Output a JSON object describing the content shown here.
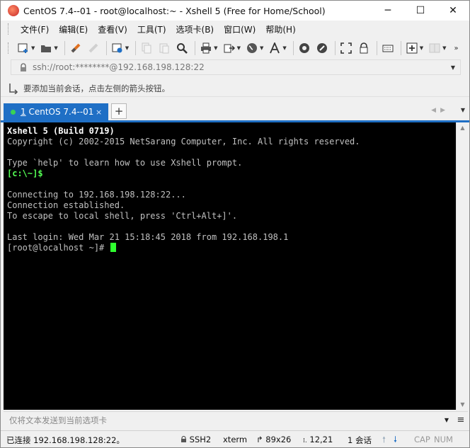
{
  "window": {
    "title": "CentOS 7.4--01 - root@localhost:~ - Xshell 5 (Free for Home/School)",
    "minimize": "─",
    "maximize": "☐",
    "close": "✕"
  },
  "menu": {
    "items": [
      "文件(F)",
      "编辑(E)",
      "查看(V)",
      "工具(T)",
      "选项卡(B)",
      "窗口(W)",
      "帮助(H)"
    ]
  },
  "address": {
    "value": "ssh://root:********@192.168.198.128:22"
  },
  "hint": {
    "text": "要添加当前会话，点击左侧的箭头按钮。"
  },
  "tab": {
    "number": "1",
    "label": "CentOS 7.4--01",
    "close": "×",
    "new": "+"
  },
  "terminal": {
    "lines": [
      "Xshell 5 (Build 0719)",
      "Copyright (c) 2002-2015 NetSarang Computer, Inc. All rights reserved.",
      "",
      "Type `help' to learn how to use Xshell prompt.",
      "[c:\\~]$",
      "",
      "Connecting to 192.168.198.128:22...",
      "Connection established.",
      "To escape to local shell, press 'Ctrl+Alt+]'.",
      "",
      "Last login: Wed Mar 21 15:18:45 2018 from 192.168.198.1",
      "[root@localhost ~]# "
    ]
  },
  "compose": {
    "placeholder": "仅将文本发送到当前选项卡"
  },
  "status": {
    "connection": "已连接 192.168.198.128:22。",
    "protocol": "SSH2",
    "terminal_type": "xterm",
    "size": "89x26",
    "position": "12,21",
    "sessions": "1 会话",
    "caps": "CAP",
    "num": "NUM"
  },
  "colors": {
    "accent": "#1f6fc5",
    "terminal_bg": "#000000",
    "cursor": "#2fff2f",
    "prompt_green": "#54ff54"
  }
}
